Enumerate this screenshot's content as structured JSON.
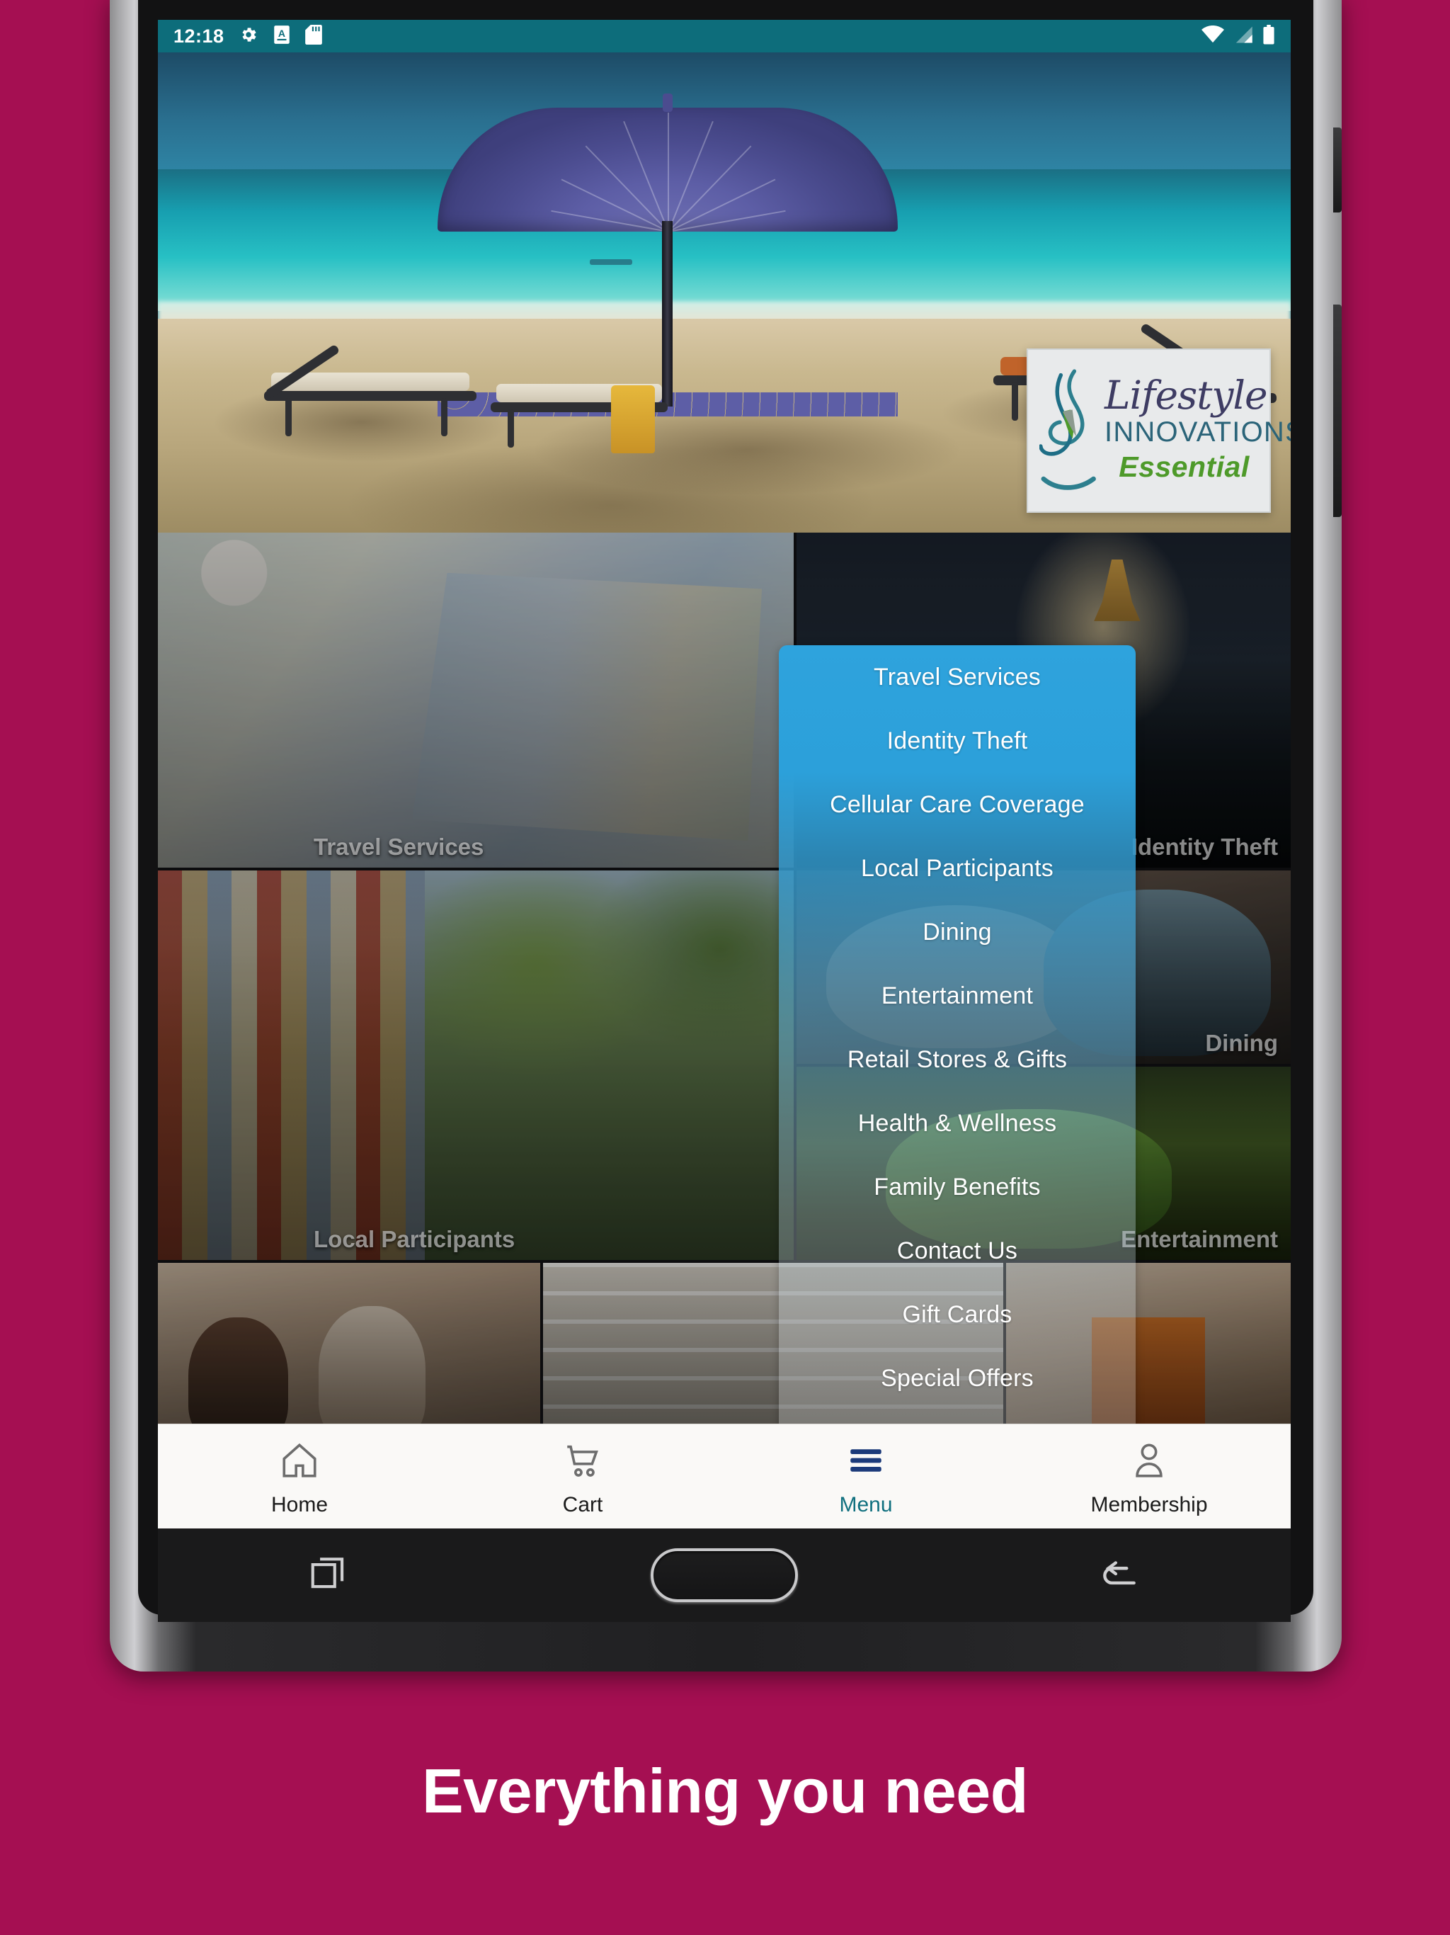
{
  "background_color": "#a50f52",
  "statusbar": {
    "time": "12:18",
    "background_color": "#0d6d7b",
    "left_icons": [
      "gear-icon",
      "a-badge-icon",
      "sd-card-icon"
    ],
    "right_icons": [
      "wifi-icon",
      "cellular-signal-icon",
      "battery-icon"
    ]
  },
  "hero": {
    "alt": "beach-with-umbrella-and-loungers",
    "logo": {
      "script_text": "Lifestyle",
      "name_text": "INNOVATIONS",
      "tier_text": "Essential"
    }
  },
  "tiles": [
    {
      "label": "Travel Services",
      "art": "art-travel"
    },
    {
      "label": "Identity Theft",
      "art": "art-idtheft"
    },
    {
      "label": "Local Participants",
      "art": "art-local"
    },
    {
      "label": "Dining",
      "art": "art-dining"
    },
    {
      "label": "Entertainment",
      "art": "art-ent"
    },
    {
      "label": "",
      "art": "art-family"
    },
    {
      "label": "",
      "art": "art-pharm"
    },
    {
      "label": "",
      "art": "art-shop"
    }
  ],
  "menu": {
    "accent_color": "#2ea3dd",
    "items": [
      "Travel Services",
      "Identity Theft",
      "Cellular Care Coverage",
      "Local Participants",
      "Dining",
      "Entertainment",
      "Retail Stores & Gifts",
      "Health & Wellness",
      "Family Benefits",
      "Contact Us",
      "Gift Cards",
      "Special Offers"
    ]
  },
  "bottom_nav": {
    "active_color": "#10707f",
    "items": [
      {
        "label": "Home",
        "icon": "home-icon",
        "active": false
      },
      {
        "label": "Cart",
        "icon": "cart-icon",
        "active": false
      },
      {
        "label": "Menu",
        "icon": "hamburger-icon",
        "active": true
      },
      {
        "label": "Membership",
        "icon": "person-icon",
        "active": false
      }
    ]
  },
  "soft_keys": [
    "recents-icon",
    "home-button",
    "back-icon"
  ],
  "tagline": "Everything you need"
}
